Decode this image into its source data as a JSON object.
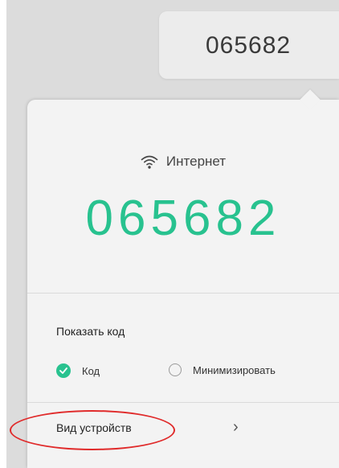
{
  "code_chip": {
    "code": "065682"
  },
  "connection": {
    "icon": "wifi-icon",
    "label": "Интернет",
    "code": "065682"
  },
  "show_code": {
    "title": "Показать код",
    "options": [
      {
        "label": "Код",
        "selected": true
      },
      {
        "label": "Минимизировать",
        "selected": false
      }
    ]
  },
  "device_view": {
    "label": "Вид устройств",
    "icon": "chevron-right-icon"
  },
  "colors": {
    "accent": "#28c28f",
    "highlight": "#e02b2b"
  }
}
